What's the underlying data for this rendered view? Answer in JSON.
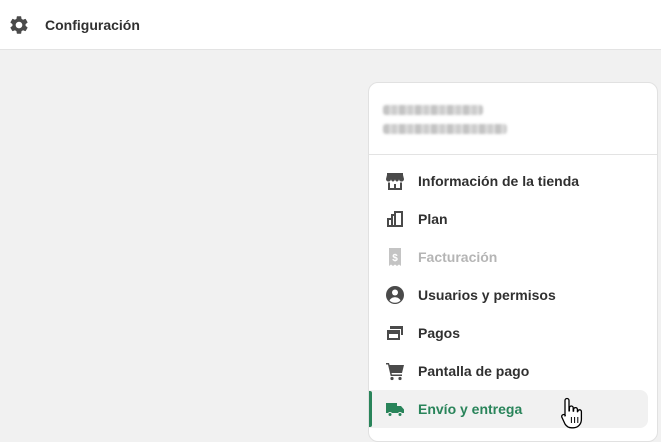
{
  "header": {
    "title": "Configuración",
    "icon": "gear-icon"
  },
  "store": {
    "name_redacted": true,
    "email_redacted": true
  },
  "menu": {
    "items": [
      {
        "label": "Información de la tienda",
        "icon": "store-icon",
        "state": "normal"
      },
      {
        "label": "Plan",
        "icon": "plan-icon",
        "state": "normal"
      },
      {
        "label": "Facturación",
        "icon": "receipt-icon",
        "state": "disabled"
      },
      {
        "label": "Usuarios y permisos",
        "icon": "user-icon",
        "state": "normal"
      },
      {
        "label": "Pagos",
        "icon": "payments-icon",
        "state": "normal"
      },
      {
        "label": "Pantalla de pago",
        "icon": "cart-icon",
        "state": "normal"
      },
      {
        "label": "Envío y entrega",
        "icon": "truck-icon",
        "state": "active"
      }
    ]
  },
  "colors": {
    "accent": "#29845a",
    "text": "#303030",
    "disabled": "#b5b5b5",
    "background": "#f1f1f1"
  }
}
